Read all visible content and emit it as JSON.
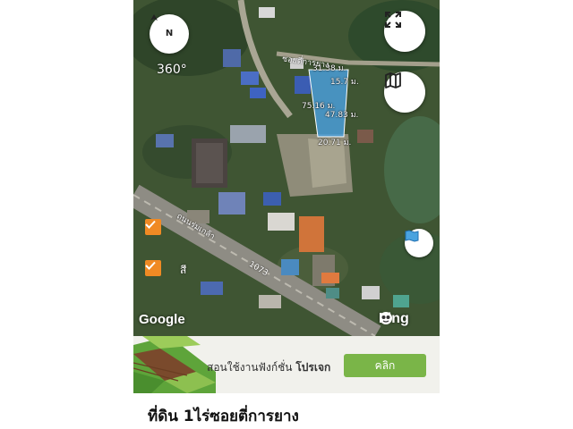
{
  "map": {
    "heading": "360°",
    "compass_label": "N",
    "google_label": "Google",
    "ling_label": "Ling",
    "checkbox_label": "สี",
    "road_soi_label": "ซอยตี่การยาง",
    "road_main_label": "ถนนร่มเกล้า",
    "road_number_label": "1073",
    "measurements": [
      "31.38 ม.",
      "15.7 ม.",
      "75.16 ม.",
      "47.83 ม.",
      "20.71 ม."
    ]
  },
  "ad": {
    "text_prefix": "สอนใช้งานฟังก์ชั่น",
    "text_bold": "โปรเจก",
    "button": "คลิก"
  },
  "listing": {
    "title": "ที่ดิน 1ไร่ซอยตี่การยาง"
  },
  "colors": {
    "plot_fill": "#4a9ed8",
    "checkbox": "#f08a24",
    "ad_button": "#7ab548"
  }
}
